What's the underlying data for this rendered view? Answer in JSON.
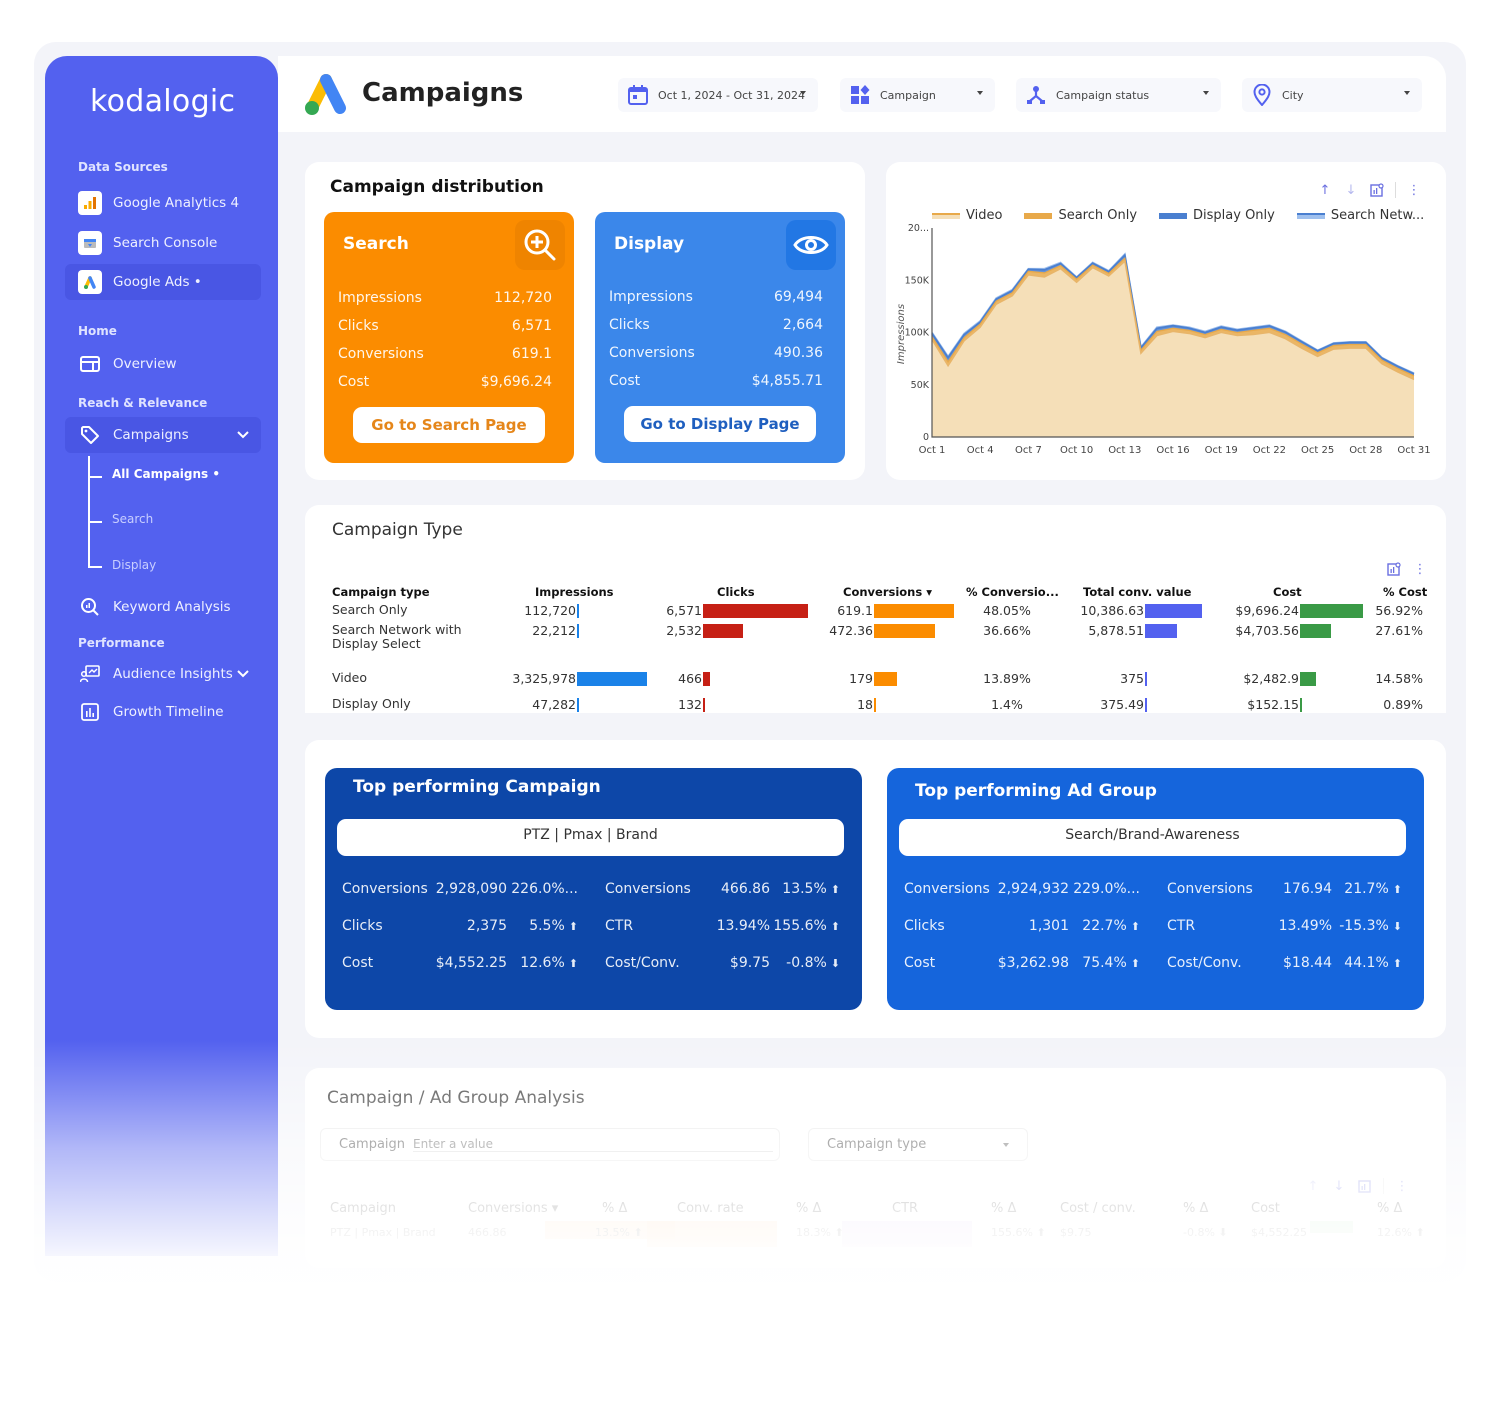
{
  "sidebar": {
    "logo": "kodalogic",
    "sections": {
      "data_sources": "Data Sources",
      "home": "Home",
      "reach": "Reach & Relevance",
      "performance": "Performance"
    },
    "data_sources": [
      {
        "label": "Google Analytics 4",
        "icon": "analytics-icon"
      },
      {
        "label": "Search Console",
        "icon": "search-console-icon"
      },
      {
        "label": "Google Ads •",
        "icon": "google-ads-icon",
        "active": true
      }
    ],
    "overview": "Overview",
    "campaigns": "Campaigns",
    "sub_items": [
      "All Campaigns •",
      "Search",
      "Display"
    ],
    "keyword_analysis": "Keyword Analysis",
    "audience_insights": "Audience Insights",
    "growth_timeline": "Growth Timeline"
  },
  "header": {
    "title": "Campaigns",
    "filters": {
      "date": "Oct 1, 2024 - Oct 31, 2024",
      "campaign": "Campaign",
      "status": "Campaign status",
      "city": "City"
    }
  },
  "distribution": {
    "title": "Campaign distribution",
    "search": {
      "title": "Search",
      "rows": [
        {
          "label": "Impressions",
          "value": "112,720"
        },
        {
          "label": "Clicks",
          "value": "6,571"
        },
        {
          "label": "Conversions",
          "value": "619.1"
        },
        {
          "label": "Cost",
          "value": "$9,696.24"
        }
      ],
      "button": "Go to Search Page",
      "color": "#fb8c00"
    },
    "display": {
      "title": "Display",
      "rows": [
        {
          "label": "Impressions",
          "value": "69,494"
        },
        {
          "label": "Clicks",
          "value": "2,664"
        },
        {
          "label": "Conversions",
          "value": "490.36"
        },
        {
          "label": "Cost",
          "value": "$4,855.71"
        }
      ],
      "button": "Go to Display Page",
      "color": "#3b87ea"
    }
  },
  "chart_data": {
    "type": "area",
    "stacked": true,
    "title": "",
    "xlabel": "",
    "ylabel": "Impressions",
    "ylim": [
      0,
      200000
    ],
    "y_ticks": [
      "0",
      "50K",
      "100K",
      "150K",
      "20..."
    ],
    "x_tick_labels": [
      "Oct 1",
      "Oct 4",
      "Oct 7",
      "Oct 10",
      "Oct 13",
      "Oct 16",
      "Oct 19",
      "Oct 22",
      "Oct 25",
      "Oct 28",
      "Oct 31"
    ],
    "legend_position": "top",
    "x": [
      "Oct 1",
      "Oct 2",
      "Oct 3",
      "Oct 4",
      "Oct 5",
      "Oct 6",
      "Oct 7",
      "Oct 8",
      "Oct 9",
      "Oct 10",
      "Oct 11",
      "Oct 12",
      "Oct 13",
      "Oct 14",
      "Oct 15",
      "Oct 16",
      "Oct 17",
      "Oct 18",
      "Oct 19",
      "Oct 20",
      "Oct 21",
      "Oct 22",
      "Oct 23",
      "Oct 24",
      "Oct 25",
      "Oct 26",
      "Oct 27",
      "Oct 28",
      "Oct 29",
      "Oct 30",
      "Oct 31"
    ],
    "series": [
      {
        "name": "Video",
        "color": "#f5dfb8",
        "values": [
          93000,
          68000,
          92000,
          105000,
          127000,
          135000,
          155000,
          153000,
          161000,
          148000,
          162000,
          154000,
          168000,
          80000,
          97000,
          101000,
          99000,
          95000,
          100000,
          97000,
          98000,
          100000,
          94000,
          85000,
          77000,
          84000,
          85000,
          85000,
          70000,
          62000,
          55000
        ]
      },
      {
        "name": "Search Only",
        "color": "#e8a94a",
        "values": [
          3000,
          4000,
          3000,
          3000,
          3000,
          3000,
          3500,
          4000,
          3000,
          3000,
          2500,
          2500,
          3000,
          3000,
          4000,
          3000,
          3000,
          3000,
          3000,
          3000,
          4000,
          4000,
          4000,
          4000,
          3500,
          3500,
          3500,
          3500,
          3500,
          3500,
          3500
        ]
      },
      {
        "name": "Display Only",
        "color": "#4a7fd0",
        "values": [
          3000,
          4000,
          3000,
          2000,
          2000,
          2000,
          2000,
          3000,
          2000,
          1500,
          1800,
          1800,
          3000,
          2200,
          3000,
          2500,
          2200,
          2000,
          2200,
          2200,
          2300,
          2300,
          2300,
          2300,
          2000,
          2000,
          2000,
          2000,
          2000,
          2000,
          2000
        ]
      },
      {
        "name": "Search Netw...",
        "color": "#9fc0ee",
        "values": [
          1000,
          1000,
          1000,
          1000,
          1000,
          1000,
          500,
          1000,
          1000,
          500,
          700,
          700,
          1000,
          800,
          1000,
          500,
          800,
          1000,
          800,
          800,
          700,
          700,
          700,
          700,
          500,
          500,
          500,
          500,
          500,
          500,
          500
        ]
      }
    ]
  },
  "campaign_type": {
    "title": "Campaign Type",
    "headers": [
      "Campaign type",
      "Impressions",
      "Clicks",
      "Conversions ▾",
      "% Conversio...",
      "Total conv. value",
      "Cost",
      "% Cost"
    ],
    "rows": [
      {
        "type": "Search Only",
        "impressions": "112,720",
        "imp_val": 112720,
        "clicks": "6,571",
        "clk_val": 6571,
        "conversions": "619.1",
        "conv_val": 619.1,
        "pct_conv": "48.05%",
        "conv_value": "10,386.63",
        "cv_val": 10386.63,
        "cost": "$9,696.24",
        "cost_val": 9696.24,
        "pct_cost": "56.92%"
      },
      {
        "type": "Search Network with Display Select",
        "impressions": "22,212",
        "imp_val": 22212,
        "clicks": "2,532",
        "clk_val": 2532,
        "conversions": "472.36",
        "conv_val": 472.36,
        "pct_conv": "36.66%",
        "conv_value": "5,878.51",
        "cv_val": 5878.51,
        "cost": "$4,703.56",
        "cost_val": 4703.56,
        "pct_cost": "27.61%"
      },
      {
        "type": "Video",
        "impressions": "3,325,978",
        "imp_val": 3325978,
        "clicks": "466",
        "clk_val": 466,
        "conversions": "179",
        "conv_val": 179,
        "pct_conv": "13.89%",
        "conv_value": "375",
        "cv_val": 375,
        "cost": "$2,482.9",
        "cost_val": 2482.9,
        "pct_cost": "14.58%"
      },
      {
        "type": "Display Only",
        "impressions": "47,282",
        "imp_val": 47282,
        "clicks": "132",
        "clk_val": 132,
        "conversions": "18",
        "conv_val": 18,
        "pct_conv": "1.4%",
        "conv_value": "375.49",
        "cv_val": 375.49,
        "cost": "$152.15",
        "cost_val": 152.15,
        "pct_cost": "0.89%"
      }
    ],
    "bar_colors": {
      "impressions": "#1a82e8",
      "clicks": "#c62015",
      "conversions": "#fb8c00",
      "conv_value": "#5361ef",
      "cost": "#3a9a46"
    }
  },
  "top_campaign": {
    "title": "Top performing Campaign",
    "name": "PTZ | Pmax | Brand",
    "left": [
      {
        "label": "Conversions",
        "value": "2,928,090",
        "delta": "226.0%...",
        "dir": ""
      },
      {
        "label": "Clicks",
        "value": "2,375",
        "delta": "5.5%",
        "dir": "up"
      },
      {
        "label": "Cost",
        "value": "$4,552.25",
        "delta": "12.6%",
        "dir": "up"
      }
    ],
    "right": [
      {
        "label": "Conversions",
        "value": "466.86",
        "delta": "13.5%",
        "dir": "up"
      },
      {
        "label": "CTR",
        "value": "13.94%",
        "delta": "155.6%",
        "dir": "up"
      },
      {
        "label": "Cost/Conv.",
        "value": "$9.75",
        "delta": "-0.8%",
        "dir": "down"
      }
    ]
  },
  "top_adgroup": {
    "title": "Top performing Ad Group",
    "name": "Search/Brand-Awareness",
    "left": [
      {
        "label": "Conversions",
        "value": "2,924,932",
        "delta": "229.0%...",
        "dir": ""
      },
      {
        "label": "Clicks",
        "value": "1,301",
        "delta": "22.7%",
        "dir": "up"
      },
      {
        "label": "Cost",
        "value": "$3,262.98",
        "delta": "75.4%",
        "dir": "up"
      }
    ],
    "right": [
      {
        "label": "Conversions",
        "value": "176.94",
        "delta": "21.7%",
        "dir": "up"
      },
      {
        "label": "CTR",
        "value": "13.49%",
        "delta": "-15.3%",
        "dir": "down"
      },
      {
        "label": "Cost/Conv.",
        "value": "$18.44",
        "delta": "44.1%",
        "dir": "up"
      }
    ]
  },
  "analysis": {
    "title": "Campaign / Ad Group Analysis",
    "campaign_label": "Campaign",
    "campaign_placeholder": "Enter a value",
    "type_select": "Campaign type",
    "headers": [
      "Campaign",
      "Conversions ▾",
      "% Δ",
      "Conv. rate",
      "% Δ",
      "CTR",
      "% Δ",
      "Cost / conv.",
      "% Δ",
      "Cost",
      "% Δ"
    ],
    "row": [
      "PTZ | Pmax | Brand",
      "466.86",
      "13.5% ⬆",
      "",
      "18.3% ⬆",
      "",
      "155.6% ⬆",
      "$9.75",
      "-0.8% ⬇",
      "$4,552.25",
      "12.6% ⬆"
    ]
  }
}
